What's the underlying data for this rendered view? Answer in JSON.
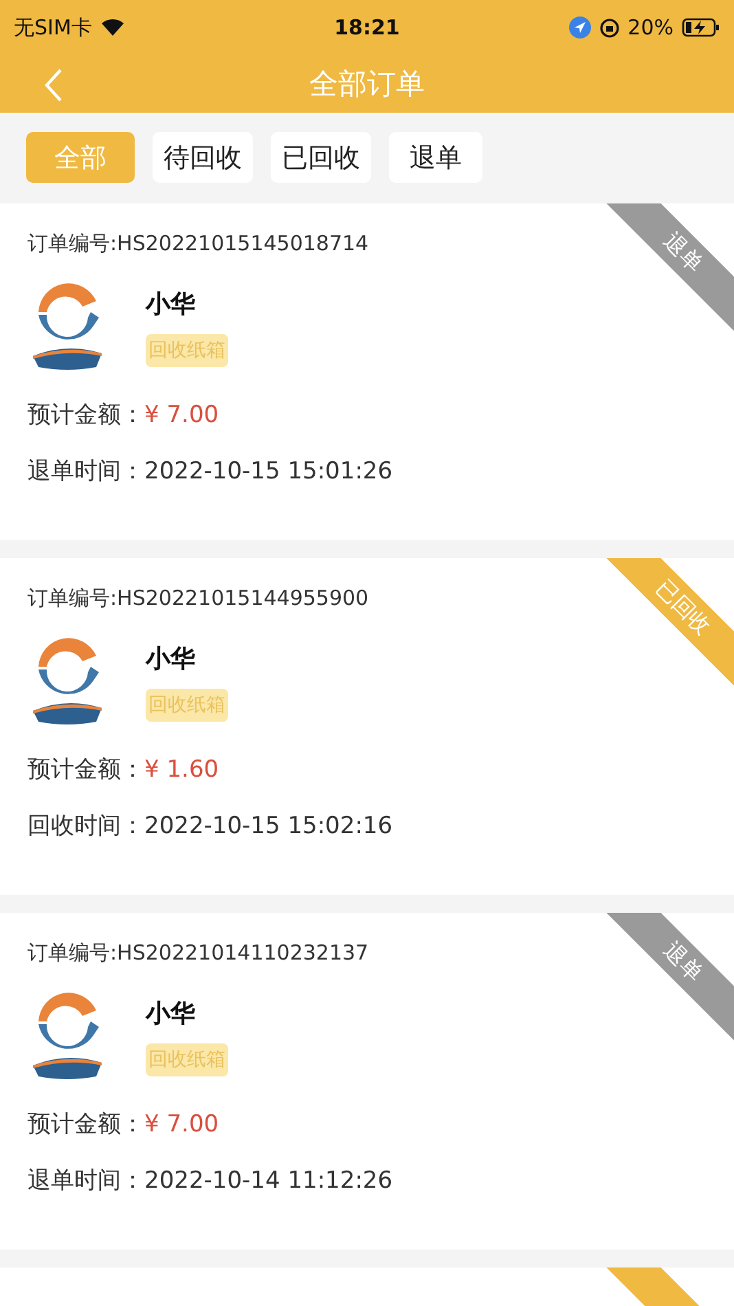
{
  "status_bar": {
    "carrier": "无SIM卡",
    "time": "18:21",
    "battery": "20%"
  },
  "nav": {
    "title": "全部订单"
  },
  "tabs": [
    {
      "label": "全部",
      "selected": true
    },
    {
      "label": "待回收",
      "selected": false
    },
    {
      "label": "已回收",
      "selected": false
    },
    {
      "label": "退单",
      "selected": false
    }
  ],
  "orders": [
    {
      "order_no": "订单编号:HS20221015145018714",
      "name": "小华",
      "tag": "回收纸箱",
      "amount_label": "预计金额：",
      "amount": "¥ 7.00",
      "time_label": "退单时间：",
      "time": "2022-10-15 15:01:26",
      "status": {
        "kind": "cancelled",
        "label": "退单"
      }
    },
    {
      "order_no": "订单编号:HS20221015144955900",
      "name": "小华",
      "tag": "回收纸箱",
      "amount_label": "预计金额：",
      "amount": "¥ 1.60",
      "time_label": "回收时间：",
      "time": "2022-10-15 15:02:16",
      "status": {
        "kind": "recycled",
        "label": "已回收"
      }
    },
    {
      "order_no": "订单编号:HS20221014110232137",
      "name": "小华",
      "tag": "回收纸箱",
      "amount_label": "预计金额：",
      "amount": "¥ 7.00",
      "time_label": "退单时间：",
      "time": "2022-10-14 11:12:26",
      "status": {
        "kind": "cancelled",
        "label": "退单"
      }
    },
    {
      "status": {
        "kind": "recycled"
      }
    }
  ]
}
